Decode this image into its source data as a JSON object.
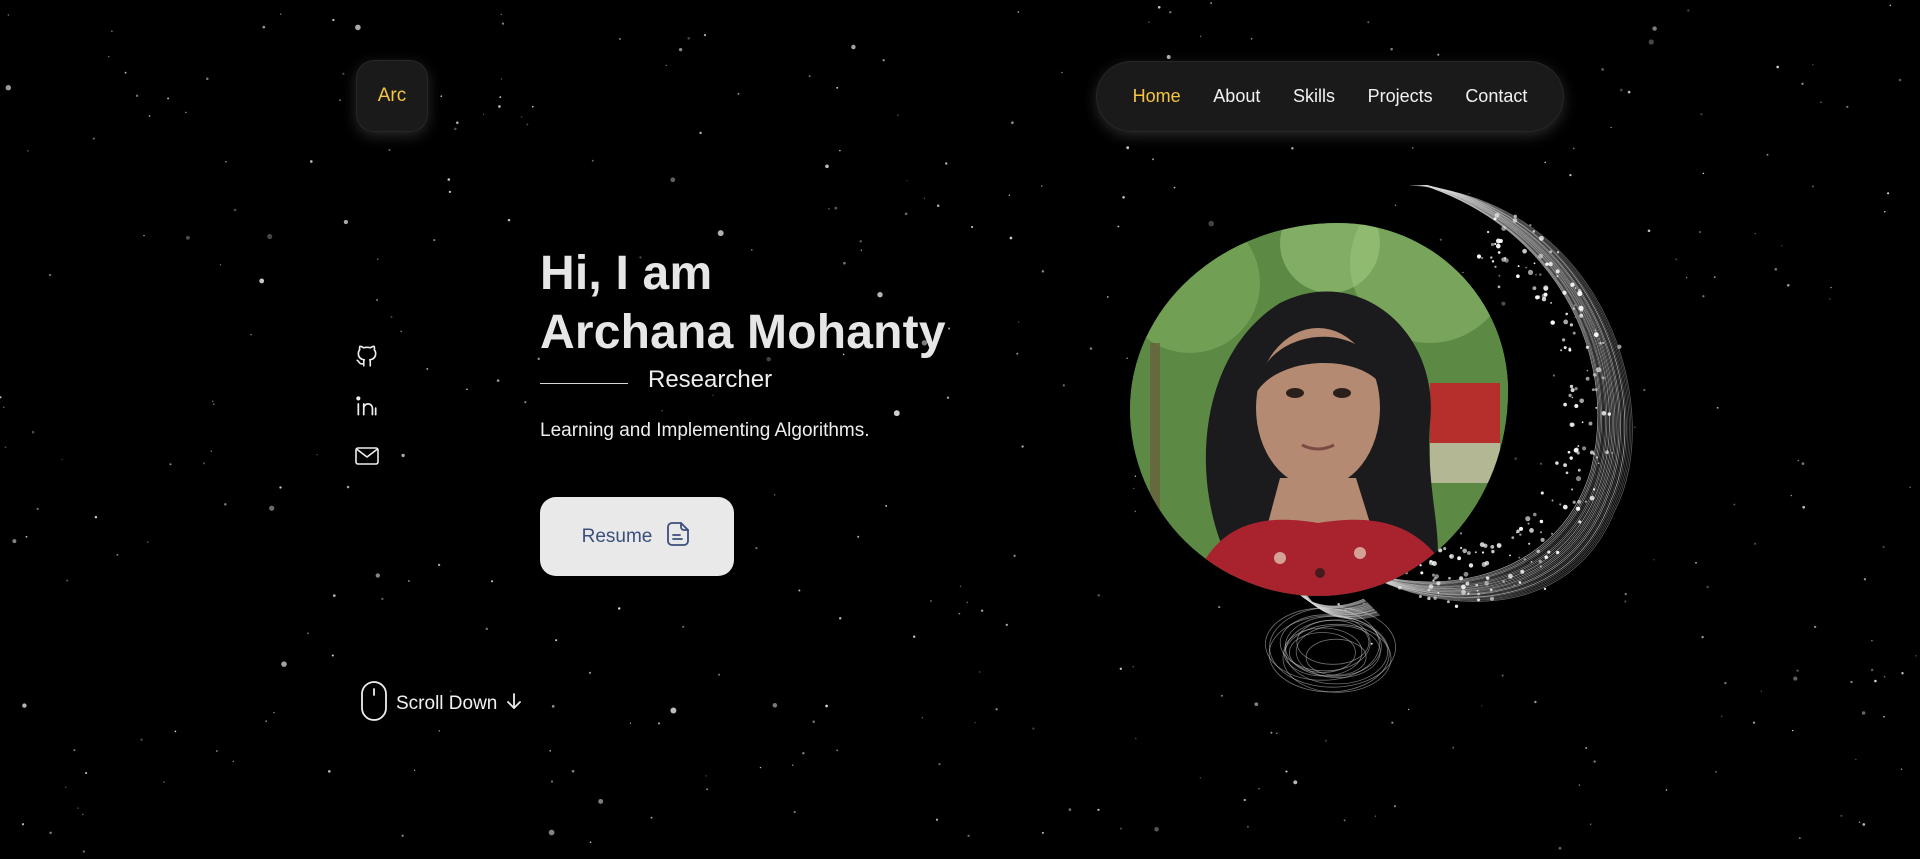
{
  "header": {
    "logo_text": "Arc",
    "nav": [
      {
        "label": "Home",
        "active": true
      },
      {
        "label": "About",
        "active": false
      },
      {
        "label": "Skills",
        "active": false
      },
      {
        "label": "Projects",
        "active": false
      },
      {
        "label": "Contact",
        "active": false
      }
    ]
  },
  "social": [
    {
      "icon": "github-icon"
    },
    {
      "icon": "linkedin-icon"
    },
    {
      "icon": "mail-icon"
    }
  ],
  "hero": {
    "greeting": "Hi, I am",
    "name": "Archana Mohanty",
    "role": "Researcher",
    "tagline": "Learning and Implementing Algorithms."
  },
  "resume": {
    "label": "Resume",
    "icon": "document-icon"
  },
  "scroll": {
    "label": "Scroll Down",
    "icon": "mouse-icon",
    "arrow_icon": "arrow-down-icon"
  },
  "colors": {
    "background": "#000000",
    "accent": "#f5c542",
    "button_bg": "#e9e9e9",
    "button_text": "#3b4f7d"
  }
}
